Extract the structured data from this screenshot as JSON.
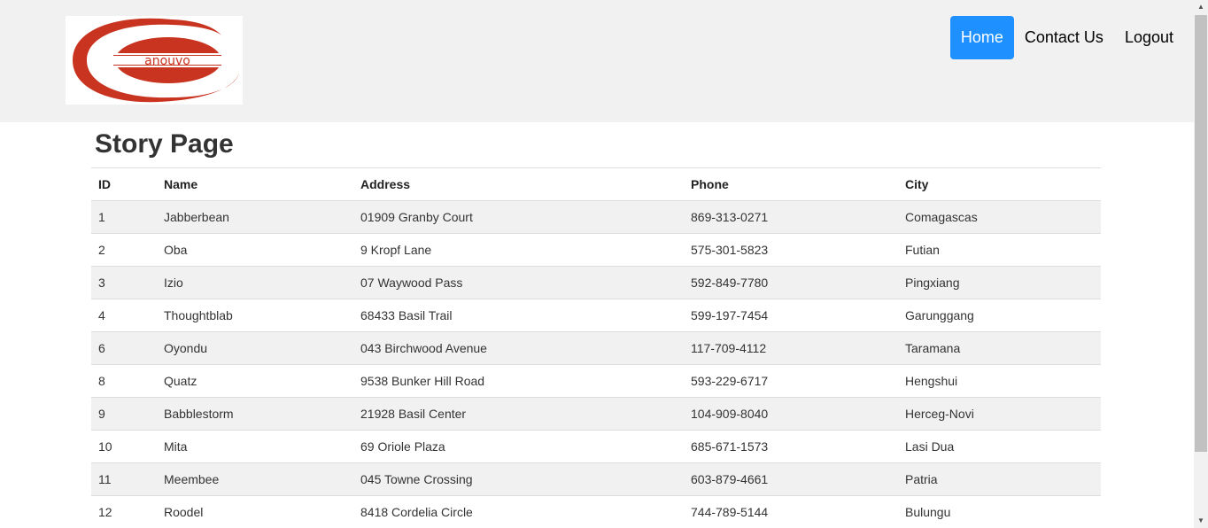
{
  "logo": {
    "text": "anouvo",
    "icon": "anouvo-logo",
    "color": "#c8341f"
  },
  "nav": {
    "items": [
      {
        "label": "Home",
        "active": true
      },
      {
        "label": "Contact Us",
        "active": false
      },
      {
        "label": "Logout",
        "active": false
      }
    ],
    "accent": "#1e90ff"
  },
  "page_title": "Story Page",
  "table": {
    "columns": [
      "ID",
      "Name",
      "Address",
      "Phone",
      "City"
    ],
    "rows": [
      [
        "1",
        "Jabberbean",
        "01909 Granby Court",
        "869-313-0271",
        "Comagascas"
      ],
      [
        "2",
        "Oba",
        "9 Kropf Lane",
        "575-301-5823",
        "Futian"
      ],
      [
        "3",
        "Izio",
        "07 Waywood Pass",
        "592-849-7780",
        "Pingxiang"
      ],
      [
        "4",
        "Thoughtblab",
        "68433 Basil Trail",
        "599-197-7454",
        "Garunggang"
      ],
      [
        "6",
        "Oyondu",
        "043 Birchwood Avenue",
        "117-709-4112",
        "Taramana"
      ],
      [
        "8",
        "Quatz",
        "9538 Bunker Hill Road",
        "593-229-6717",
        "Hengshui"
      ],
      [
        "9",
        "Babblestorm",
        "21928 Basil Center",
        "104-909-8040",
        "Herceg-Novi"
      ],
      [
        "10",
        "Mita",
        "69 Oriole Plaza",
        "685-671-1573",
        "Lasi Dua"
      ],
      [
        "11",
        "Meembee",
        "045 Towne Crossing",
        "603-879-4661",
        "Patria"
      ],
      [
        "12",
        "Roodel",
        "8418 Cordelia Circle",
        "744-789-5144",
        "Bulungu"
      ]
    ]
  }
}
